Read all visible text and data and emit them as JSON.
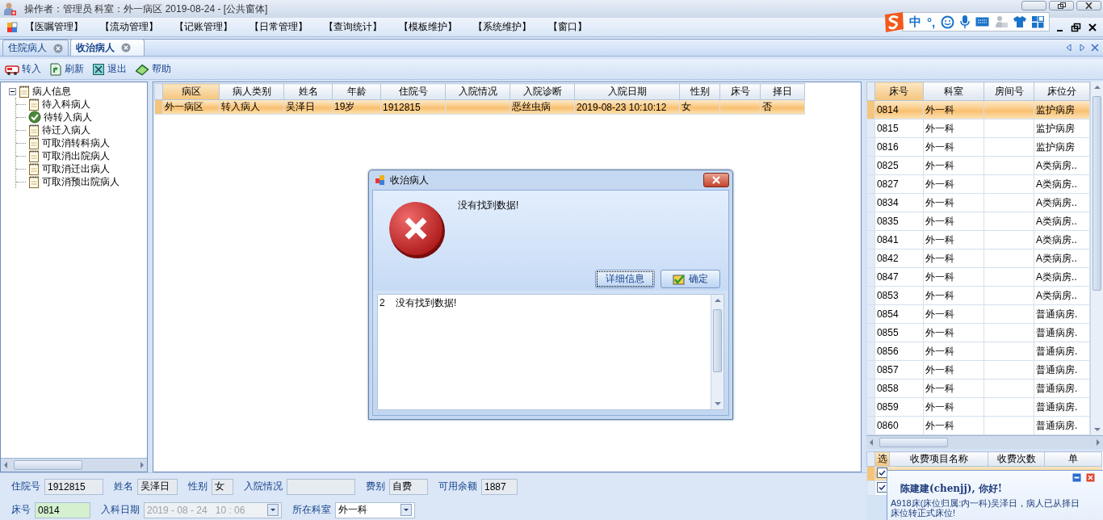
{
  "window": {
    "title": "操作者：管理员  科室：外一病区  2019-08-24 - [公共窗体]"
  },
  "menu": [
    "【医嘱管理】",
    "【流动管理】",
    "【记账管理】",
    "【日常管理】",
    "【查询统计】",
    "【模板维护】",
    "【系统维护】",
    "【窗口】"
  ],
  "ime": {
    "mode": "中",
    "punct": "°,"
  },
  "tabs": [
    {
      "label": "住院病人",
      "selected": false
    },
    {
      "label": "收治病人",
      "selected": true
    }
  ],
  "toolbar": [
    {
      "label": "转入",
      "kind": "transfer"
    },
    {
      "label": "刷新",
      "kind": "refresh"
    },
    {
      "label": "退出",
      "kind": "exit"
    },
    {
      "label": "帮助",
      "kind": "help"
    }
  ],
  "tree": {
    "label": "病人信息",
    "expanded": true,
    "children": [
      {
        "label": "待入科病人",
        "kind": "note"
      },
      {
        "label": "待转入病人",
        "kind": "check"
      },
      {
        "label": "待迁入病人",
        "kind": "note"
      },
      {
        "label": "可取消转科病人",
        "kind": "note"
      },
      {
        "label": "可取消出院病人",
        "kind": "note"
      },
      {
        "label": "可取消迁出病人",
        "kind": "note"
      },
      {
        "label": "可取消预出院病人",
        "kind": "note"
      }
    ]
  },
  "patient_table": {
    "columns": [
      {
        "label": "病区",
        "selected": true
      },
      {
        "label": "病人类别",
        "selected": false
      },
      {
        "label": "姓名",
        "selected": false
      },
      {
        "label": "年龄",
        "selected": false
      },
      {
        "label": "住院号",
        "selected": false
      },
      {
        "label": "入院情况",
        "selected": false
      },
      {
        "label": "入院诊断",
        "selected": false
      },
      {
        "label": "入院日期",
        "selected": false
      },
      {
        "label": "性别",
        "selected": false
      },
      {
        "label": "床号",
        "selected": false
      },
      {
        "label": "择日",
        "selected": false
      }
    ],
    "rows": [
      {
        "selected": true,
        "cells": [
          "外一病区",
          "转入病人",
          "吴泽日",
          "19岁",
          "1912815",
          null,
          "恶丝虫病",
          "2019-08-23 10:10:12",
          "女",
          null,
          "否"
        ]
      }
    ]
  },
  "bed_table": {
    "columns": [
      {
        "label": "床号",
        "selected": true
      },
      {
        "label": "科室",
        "selected": false
      },
      {
        "label": "房间号",
        "selected": false
      },
      {
        "label": "床位分",
        "selected": false
      }
    ],
    "rows": [
      {
        "selected": true,
        "cells": [
          "0814",
          "外一科",
          null,
          "监护病房"
        ]
      },
      {
        "selected": false,
        "cells": [
          "0815",
          "外一科",
          null,
          "监护病房"
        ]
      },
      {
        "selected": false,
        "cells": [
          "0816",
          "外一科",
          null,
          "监护病房"
        ]
      },
      {
        "selected": false,
        "cells": [
          "0825",
          "外一科",
          null,
          "A类病房.."
        ]
      },
      {
        "selected": false,
        "cells": [
          "0827",
          "外一科",
          null,
          "A类病房.."
        ]
      },
      {
        "selected": false,
        "cells": [
          "0834",
          "外一科",
          null,
          "A类病房.."
        ]
      },
      {
        "selected": false,
        "cells": [
          "0835",
          "外一科",
          null,
          "A类病房.."
        ]
      },
      {
        "selected": false,
        "cells": [
          "0841",
          "外一科",
          null,
          "A类病房.."
        ]
      },
      {
        "selected": false,
        "cells": [
          "0842",
          "外一科",
          null,
          "A类病房.."
        ]
      },
      {
        "selected": false,
        "cells": [
          "0847",
          "外一科",
          null,
          "A类病房.."
        ]
      },
      {
        "selected": false,
        "cells": [
          "0853",
          "外一科",
          null,
          "A类病房.."
        ]
      },
      {
        "selected": false,
        "cells": [
          "0854",
          "外一科",
          null,
          "普通病房."
        ]
      },
      {
        "selected": false,
        "cells": [
          "0855",
          "外一科",
          null,
          "普通病房."
        ]
      },
      {
        "selected": false,
        "cells": [
          "0856",
          "外一科",
          null,
          "普通病房."
        ]
      },
      {
        "selected": false,
        "cells": [
          "0857",
          "外一科",
          null,
          "普通病房."
        ]
      },
      {
        "selected": false,
        "cells": [
          "0858",
          "外一科",
          null,
          "普通病房."
        ]
      },
      {
        "selected": false,
        "cells": [
          "0859",
          "外一科",
          null,
          "普通病房."
        ]
      },
      {
        "selected": false,
        "cells": [
          "0860",
          "外一科",
          null,
          "普通病房."
        ]
      }
    ]
  },
  "fee_table": {
    "columns": [
      {
        "label": "选",
        "selected": true
      },
      {
        "label": "收费项目名称",
        "selected": false
      },
      {
        "label": "收费次数",
        "selected": false
      },
      {
        "label": "单",
        "selected": false
      }
    ],
    "rows": [
      {
        "selected": true,
        "checked": true
      },
      {
        "selected": false,
        "checked": true
      }
    ]
  },
  "form": [
    [
      {
        "label": "住院号",
        "value": "1912815",
        "kind": "text"
      },
      {
        "label": "姓名",
        "value": "吴泽日",
        "kind": "text"
      },
      {
        "label": "性别",
        "value": "女",
        "kind": "text"
      },
      {
        "label": "入院情况",
        "kind": "text"
      },
      {
        "label": "费别",
        "value": "自费",
        "kind": "text"
      },
      {
        "label": "可用余额",
        "value": "1887",
        "kind": "text"
      }
    ],
    [
      {
        "label": "床号",
        "value": "0814",
        "kind": "text",
        "highlight": true
      },
      {
        "label": "入科日期",
        "value": "2019 - 08 - 24   10 : 06",
        "kind": "date",
        "disabled": true
      },
      {
        "label": "所在科室",
        "value": "外一科",
        "kind": "combo"
      }
    ]
  ],
  "dialog": {
    "title": "收治病人",
    "message": "没有找到数据!",
    "buttons": [
      {
        "label": "详细信息",
        "kind": "plain",
        "focused": true
      },
      {
        "label": "确定",
        "kind": "ok",
        "focused": false
      }
    ],
    "detail": "2    没有找到数据!"
  },
  "notice": {
    "greeting": "陈建建(chenjj), 你好!",
    "lines": [
      "A918床(床位归属:内一科)吴泽日，病人已从择日",
      "床位转正式床位!"
    ]
  }
}
